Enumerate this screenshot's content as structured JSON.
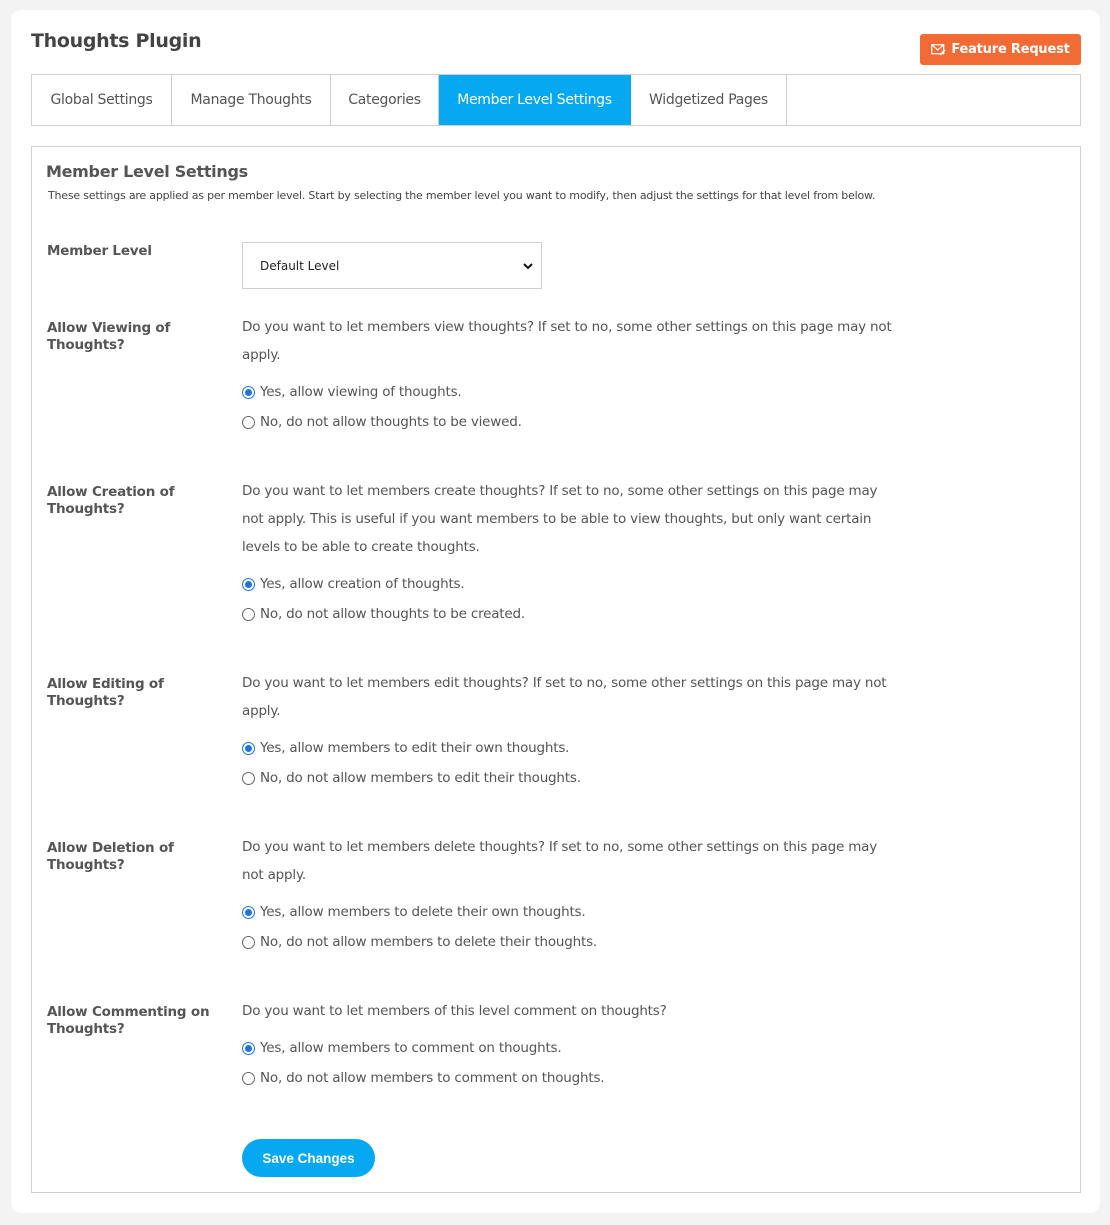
{
  "header": {
    "title": "Thoughts Plugin",
    "feature_request_label": "Feature Request",
    "feature_request_icon": "envelope-edit-icon",
    "feature_request_color": "#f26b35"
  },
  "tabs": [
    {
      "label": "Global Settings",
      "active": false
    },
    {
      "label": "Manage Thoughts",
      "active": false
    },
    {
      "label": "Categories",
      "active": false
    },
    {
      "label": "Member Level Settings",
      "active": true
    },
    {
      "label": "Widgetized Pages",
      "active": false
    }
  ],
  "accent_color": "#05a8f1",
  "panel": {
    "title": "Member Level Settings",
    "description": "These settings are applied as per member level. Start by selecting the member level you want to modify, then adjust the settings for that level from below.",
    "member_level": {
      "label": "Member Level",
      "selected": "Default Level"
    },
    "settings": [
      {
        "label": "Allow Viewing of Thoughts?",
        "description": "Do you want to let members view thoughts? If set to no, some other settings on this page may not apply.",
        "options": [
          {
            "label": "Yes, allow viewing of thoughts.",
            "checked": true
          },
          {
            "label": "No, do not allow thoughts to be viewed.",
            "checked": false
          }
        ]
      },
      {
        "label": "Allow Creation of Thoughts?",
        "description": "Do you want to let members create thoughts? If set to no, some other settings on this page may not apply. This is useful if you want members to be able to view thoughts, but only want certain levels to be able to create thoughts.",
        "options": [
          {
            "label": "Yes, allow creation of thoughts.",
            "checked": true
          },
          {
            "label": "No, do not allow thoughts to be created.",
            "checked": false
          }
        ]
      },
      {
        "label": "Allow Editing of Thoughts?",
        "description": "Do you want to let members edit thoughts? If set to no, some other settings on this page may not apply.",
        "options": [
          {
            "label": "Yes, allow members to edit their own thoughts.",
            "checked": true
          },
          {
            "label": "No, do not allow members to edit their thoughts.",
            "checked": false
          }
        ]
      },
      {
        "label": "Allow Deletion of Thoughts?",
        "description": "Do you want to let members delete thoughts? If set to no, some other settings on this page may not apply.",
        "options": [
          {
            "label": "Yes, allow members to delete their own thoughts.",
            "checked": true
          },
          {
            "label": "No, do not allow members to delete their thoughts.",
            "checked": false
          }
        ]
      },
      {
        "label": "Allow Commenting on Thoughts?",
        "description": "Do you want to let members of this level comment on thoughts?",
        "options": [
          {
            "label": "Yes, allow members to comment on thoughts.",
            "checked": true
          },
          {
            "label": "No, do not allow members to comment on thoughts.",
            "checked": false
          }
        ]
      }
    ],
    "save_label": "Save Changes"
  }
}
